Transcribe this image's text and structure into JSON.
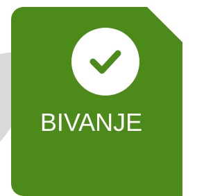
{
  "tile": {
    "label": "BIVANJE",
    "icon": "check-icon",
    "colors": {
      "tile_background": "#4c8a1a",
      "icon_circle": "#ffffff",
      "checkmark": "#4c8a1a",
      "label_text": "#ffffff",
      "background_swoosh": "#d9d9dc"
    }
  }
}
